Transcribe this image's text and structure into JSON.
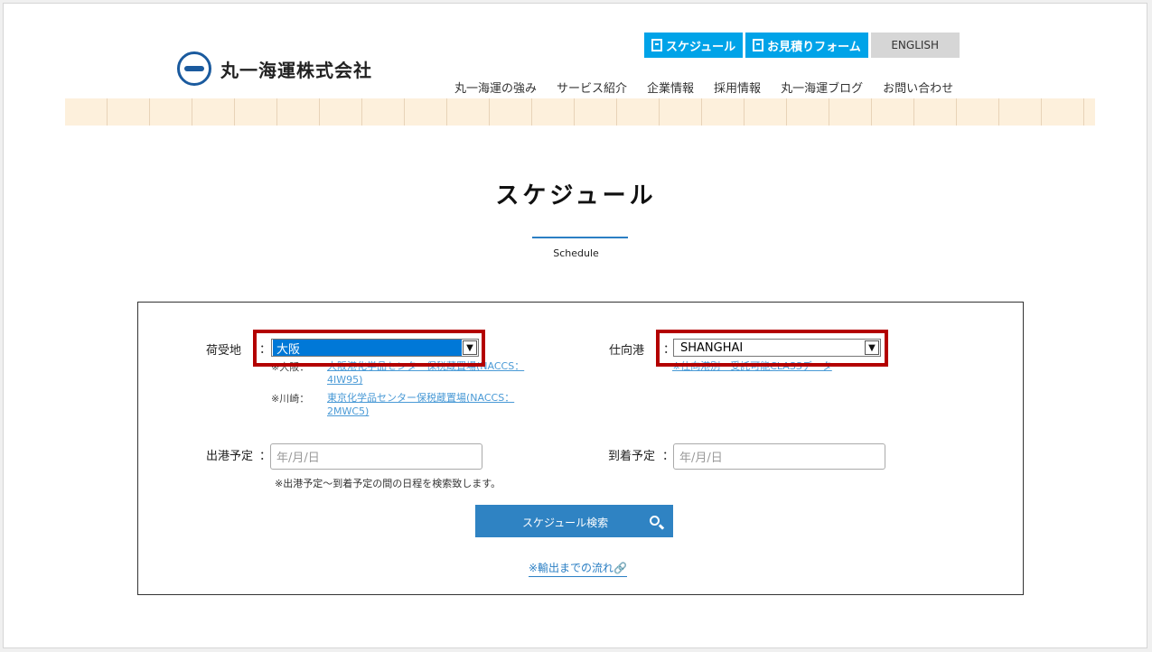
{
  "header": {
    "company_name": "丸一海運株式会社",
    "top_buttons": [
      "スケジュール",
      "お見積りフォーム",
      "ENGLISH"
    ],
    "nav": [
      "丸一海運の強み",
      "サービス紹介",
      "企業情報",
      "採用情報",
      "丸一海運ブログ",
      "お問い合わせ"
    ]
  },
  "page": {
    "title": "スケジュール",
    "subtitle": "Schedule"
  },
  "form": {
    "origin_label": "荷受地",
    "origin_colon": "：",
    "origin_value": "大阪",
    "origin_notes": [
      {
        "mark": "※大阪：",
        "text": "大阪港化学品センター保税蔵置場(NACCS：4IW95)"
      },
      {
        "mark": "※川崎：",
        "text": "東京化学品センター保税蔵置場(NACCS：2MWC5)"
      }
    ],
    "dest_label": "仕向港",
    "dest_colon": "：",
    "dest_value": "SHANGHAI",
    "dest_note": "※仕向港別　受託可能CLASSデータ",
    "depart_label": "出港予定",
    "depart_colon": "：",
    "depart_placeholder": "年/月/日",
    "arrive_label": "到着予定",
    "arrive_colon": "：",
    "arrive_placeholder": "年/月/日",
    "date_note": "※出港予定〜到着予定の間の日程を検索致します。",
    "search_button": "スケジュール検索",
    "flow_link": "※輸出までの流れ",
    "flow_icon": "🔗"
  },
  "colors": {
    "accent": "#00a3e8",
    "button": "#2f83c3",
    "highlight": "#b30000"
  }
}
